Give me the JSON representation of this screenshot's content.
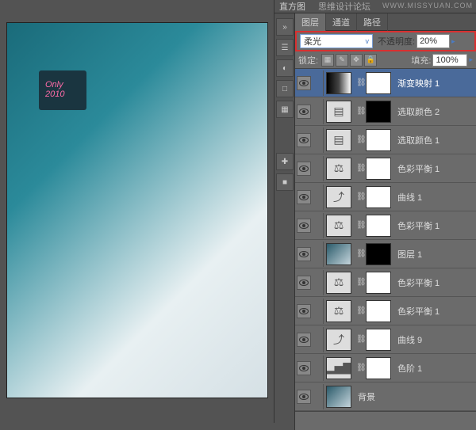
{
  "watermark": "WWW.MISSYUAN.COM",
  "header_tabs": {
    "histogram": "直方图",
    "forum": "思维设计论坛"
  },
  "panel_tabs": {
    "layers": "图层",
    "channels": "通道",
    "paths": "路径"
  },
  "blend_row": {
    "mode": "柔光",
    "opacity_label": "不透明度:",
    "opacity_value": "20%"
  },
  "lock_row": {
    "label": "锁定:",
    "fill_label": "填充:",
    "fill_value": "100%"
  },
  "canvas": {
    "sign_text": "Only",
    "sign_year": "2010"
  },
  "layers": [
    {
      "name": "渐变映射 1",
      "type": "grad",
      "mask": "white",
      "selected": true
    },
    {
      "name": "选取颜色 2",
      "type": "adj",
      "icon": "▤",
      "mask": "dark"
    },
    {
      "name": "选取颜色 1",
      "type": "adj",
      "icon": "▤",
      "mask": "white"
    },
    {
      "name": "色彩平衡 1",
      "type": "adj",
      "icon": "⚖",
      "mask": "white"
    },
    {
      "name": "曲线 1",
      "type": "adj",
      "icon": "⤴",
      "mask": "white"
    },
    {
      "name": "色彩平衡 1",
      "type": "adj",
      "icon": "⚖",
      "mask": "white"
    },
    {
      "name": "图层 1",
      "type": "img",
      "icon": "",
      "mask": "dark"
    },
    {
      "name": "色彩平衡 1",
      "type": "adj",
      "icon": "⚖",
      "mask": "white"
    },
    {
      "name": "色彩平衡 1",
      "type": "adj",
      "icon": "⚖",
      "mask": "white"
    },
    {
      "name": "曲线 9",
      "type": "adj",
      "icon": "⤴",
      "mask": "white"
    },
    {
      "name": "色阶 1",
      "type": "adj",
      "icon": "▂▅▇",
      "mask": "white"
    },
    {
      "name": "背景",
      "type": "bg",
      "icon": "",
      "mask": "none"
    }
  ],
  "tool_icons": [
    "»",
    "☰",
    "◐",
    "□",
    "▦",
    "✚",
    "■"
  ]
}
